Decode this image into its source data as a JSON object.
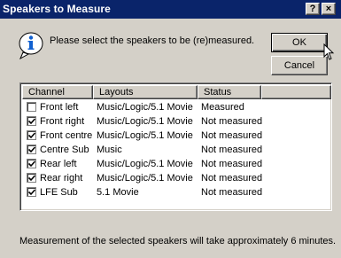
{
  "window": {
    "title": "Speakers to Measure",
    "help_glyph": "?",
    "close_glyph": "×"
  },
  "prompt": "Please select the speakers to be (re)measured.",
  "buttons": {
    "ok": "OK",
    "cancel": "Cancel"
  },
  "columns": [
    "Channel",
    "Layouts",
    "Status"
  ],
  "rows": [
    {
      "channel": "Front left",
      "layouts": "Music/Logic/5.1 Movie",
      "status": "Measured",
      "checked": false
    },
    {
      "channel": "Front right",
      "layouts": "Music/Logic/5.1 Movie",
      "status": "Not measured",
      "checked": true
    },
    {
      "channel": "Front centre",
      "layouts": "Music/Logic/5.1 Movie",
      "status": "Not measured",
      "checked": true
    },
    {
      "channel": "Centre Sub",
      "layouts": "Music",
      "status": "Not measured",
      "checked": true
    },
    {
      "channel": "Rear left",
      "layouts": "Music/Logic/5.1 Movie",
      "status": "Not measured",
      "checked": true
    },
    {
      "channel": "Rear right",
      "layouts": "Music/Logic/5.1 Movie",
      "status": "Not measured",
      "checked": true
    },
    {
      "channel": "LFE Sub",
      "layouts": "5.1 Movie",
      "status": "Not measured",
      "checked": true
    }
  ],
  "footer": "Measurement of the selected speakers will take approximately 6 minutes.",
  "colors": {
    "titlebar": "#0a246a",
    "face": "#d4d0c8",
    "info_blue": "#1060d0"
  },
  "icons": {
    "info": "info-icon",
    "check": "check-icon",
    "cursor": "mouse-cursor-icon"
  }
}
